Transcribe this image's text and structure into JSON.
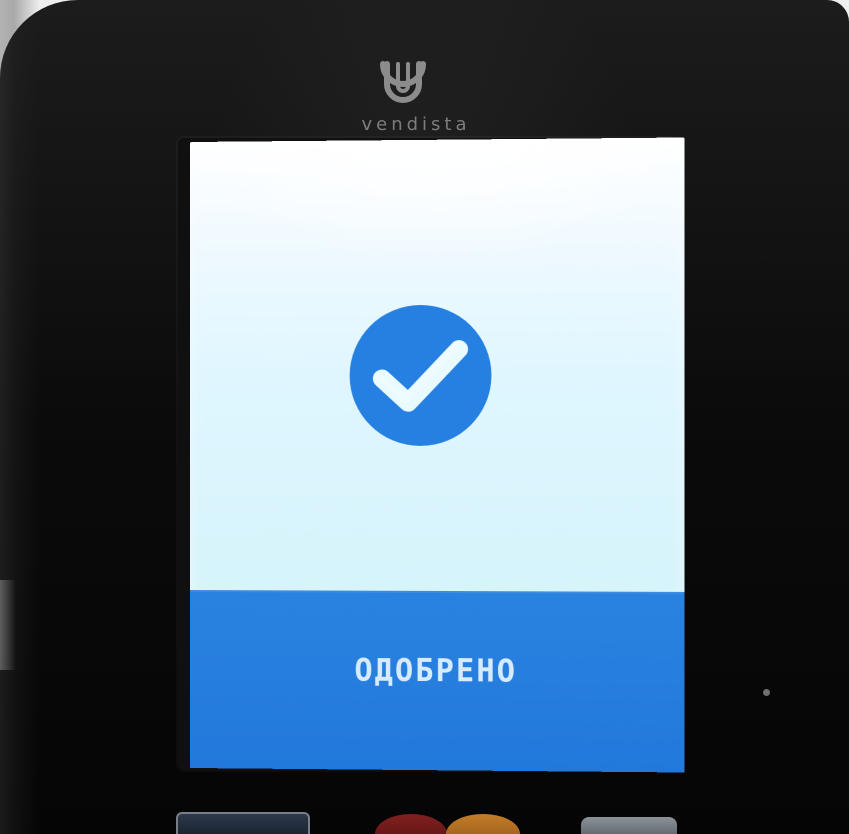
{
  "brand": {
    "name": "vendista",
    "logo_icon": "vendista-logo-icon"
  },
  "screen": {
    "status_icon": "checkmark-circle-icon",
    "status_text": "ОДОБРЕНО"
  },
  "device": {
    "controls": {
      "left": "device-button",
      "red": "device-red-button",
      "orange": "device-orange-button",
      "right": "device-button"
    }
  },
  "colors": {
    "device_body": "#0b0b0b",
    "screen_background": "#d7f4fb",
    "status_bar": "#2279db",
    "success_icon": "#2680e1",
    "status_text": "#d7ebff",
    "logo": "#8e8e8e"
  }
}
